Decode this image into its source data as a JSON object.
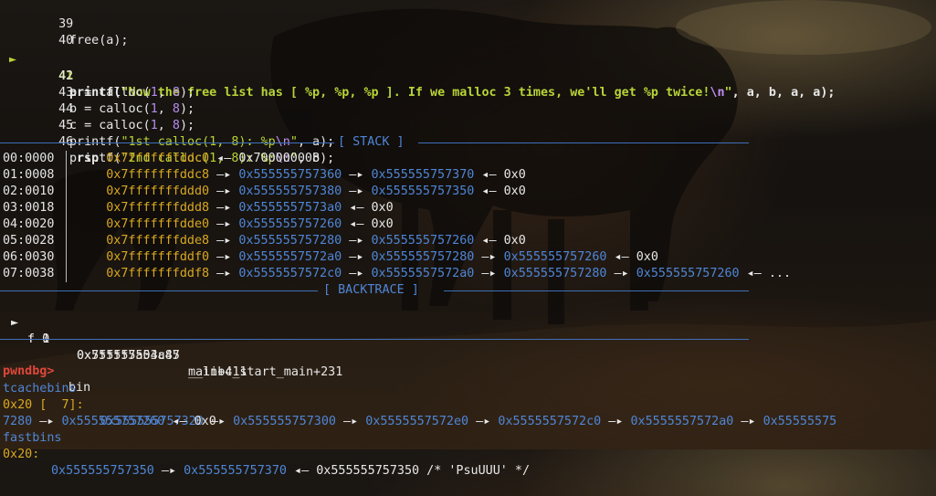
{
  "source": {
    "lines": [
      {
        "no": "39",
        "text": "free(a);",
        "current": false
      },
      {
        "no": "40",
        "text": "",
        "current": false
      },
      {
        "no": "41",
        "current": true,
        "parts": {
          "fn": "printf(",
          "s1": "\"Now the free list has [ %p, %p, %p ]. If we malloc 3 times, we'll get %p twice!",
          "esc": "\\n",
          "s2": "\"",
          "args": ", a, b, a, a);"
        }
      },
      {
        "no": "42",
        "parts": {
          "pre": "a = calloc(",
          "n1": "1",
          "mid": ", ",
          "n2": "8",
          "post": ");"
        }
      },
      {
        "no": "43",
        "parts": {
          "pre": "b = calloc(",
          "n1": "1",
          "mid": ", ",
          "n2": "8",
          "post": ");"
        }
      },
      {
        "no": "44",
        "parts": {
          "pre": "c = calloc(",
          "n1": "1",
          "mid": ", ",
          "n2": "8",
          "post": ");"
        }
      },
      {
        "no": "45",
        "parts": {
          "fn": "printf(",
          "s1": "\"1st calloc(1, 8): %p",
          "esc": "\\n",
          "s2": "\"",
          "args": ", a);"
        }
      },
      {
        "no": "46",
        "parts": {
          "fn": "printf(",
          "s1": "\"2nd calloc(1, 8): %p",
          "esc": "\\n",
          "s2": "\"",
          "args": ", b);"
        }
      }
    ],
    "current_marker": "►"
  },
  "sections": {
    "stack": "[ STACK ]",
    "backtrace": "[ BACKTRACE ]"
  },
  "stack": [
    {
      "off": "00:0000",
      "reg": "rsp",
      "addr": "0x7fffffffddc0",
      "chain": [
        {
          "t": "val",
          "v": "0x700000008"
        }
      ]
    },
    {
      "off": "01:0008",
      "reg": "",
      "addr": "0x7fffffffddc8",
      "chain": [
        {
          "t": "heap",
          "v": "0x555555757360"
        },
        {
          "t": "heap",
          "v": "0x555555757370"
        },
        {
          "t": "back",
          "v": "0x0"
        }
      ]
    },
    {
      "off": "02:0010",
      "reg": "",
      "addr": "0x7fffffffddd0",
      "chain": [
        {
          "t": "heap",
          "v": "0x555555757380"
        },
        {
          "t": "heap",
          "v": "0x555555757350"
        },
        {
          "t": "back",
          "v": "0x0"
        }
      ]
    },
    {
      "off": "03:0018",
      "reg": "",
      "addr": "0x7fffffffddd8",
      "chain": [
        {
          "t": "heap",
          "v": "0x5555557573a0"
        },
        {
          "t": "back",
          "v": "0x0"
        }
      ]
    },
    {
      "off": "04:0020",
      "reg": "",
      "addr": "0x7fffffffdde0",
      "chain": [
        {
          "t": "heap",
          "v": "0x555555757260"
        },
        {
          "t": "back",
          "v": "0x0"
        }
      ]
    },
    {
      "off": "05:0028",
      "reg": "",
      "addr": "0x7fffffffdde8",
      "chain": [
        {
          "t": "heap",
          "v": "0x555555757280"
        },
        {
          "t": "heap",
          "v": "0x555555757260"
        },
        {
          "t": "back",
          "v": "0x0"
        }
      ]
    },
    {
      "off": "06:0030",
      "reg": "",
      "addr": "0x7fffffffddf0",
      "chain": [
        {
          "t": "heap",
          "v": "0x5555557572a0"
        },
        {
          "t": "heap",
          "v": "0x555555757280"
        },
        {
          "t": "heap",
          "v": "0x555555757260"
        },
        {
          "t": "back",
          "v": "0x0"
        }
      ]
    },
    {
      "off": "07:0038",
      "reg": "",
      "addr": "0x7fffffffddf8",
      "chain": [
        {
          "t": "heap",
          "v": "0x5555557572c0"
        },
        {
          "t": "heap",
          "v": "0x5555557572a0"
        },
        {
          "t": "heap",
          "v": "0x555555757280"
        },
        {
          "t": "heap",
          "v": "0x555555757260"
        },
        {
          "t": "back",
          "v": "..."
        }
      ]
    }
  ],
  "backtrace": [
    {
      "marker": "►",
      "frame": "f 0",
      "addr": "0x555555554a45",
      "sym": "main+411"
    },
    {
      "marker": "",
      "frame": "f 1",
      "addr": "0x7ffff7a03c87",
      "sym": "__libc_start_main+231"
    }
  ],
  "prompt": {
    "label": "pwndbg>",
    "command": "bin"
  },
  "bins": {
    "tcache_title": "tcachebins",
    "tcache_size": "0x20 [  7]:",
    "tcache_chain_line1": [
      "0x555555757320",
      "0x555555757300",
      "0x5555557572e0",
      "0x5555557572c0",
      "0x5555557572a0",
      "0x55555575"
    ],
    "tcache_chain_line2_a": "7280",
    "tcache_chain_line2_b": "0x555555757260",
    "tcache_chain_tail": "0x0",
    "fastbins_title": "fastbins",
    "fast_size": "0x20:",
    "fast_chain": [
      "0x555555757350",
      "0x555555757370"
    ],
    "fast_back": "0x555555757350",
    "fast_comment": "/* 'PsuUUU' */"
  },
  "glyphs": {
    "arrow": "—▸",
    "back": "◂—"
  },
  "colors": {
    "accent_green": "#b8d437",
    "stack_yellow": "#d9a820",
    "heap_blue": "#4f86d6",
    "prompt_red": "#e0463a",
    "format_purple": "#c08cf0"
  }
}
